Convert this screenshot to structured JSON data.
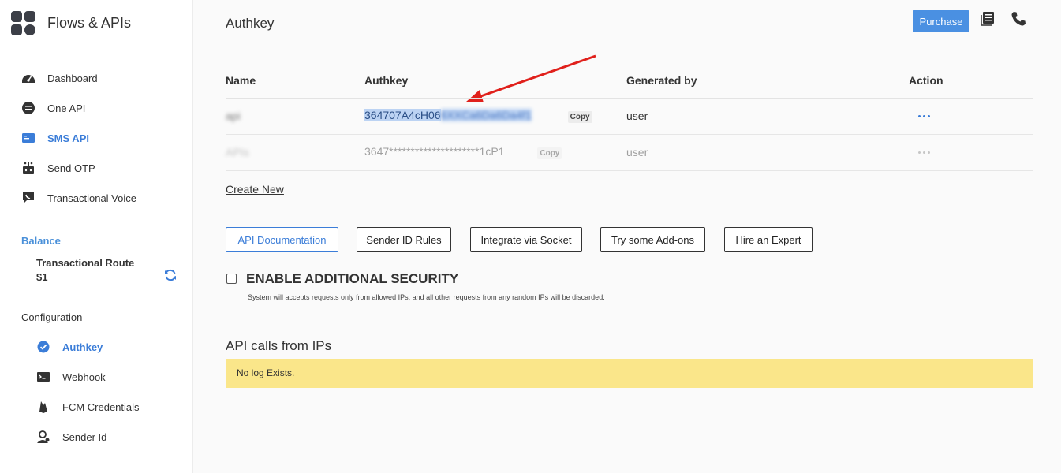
{
  "brand": {
    "title": "Flows & APIs"
  },
  "nav": {
    "items": [
      {
        "label": "Dashboard",
        "icon": "dashboard-icon"
      },
      {
        "label": "One API",
        "icon": "one-api-icon"
      },
      {
        "label": "SMS API",
        "icon": "sms-api-icon",
        "active": true
      },
      {
        "label": "Send OTP",
        "icon": "send-otp-icon"
      },
      {
        "label": "Transactional Voice",
        "icon": "voice-icon"
      }
    ]
  },
  "balance": {
    "title": "Balance",
    "route": "Transactional Route",
    "amount": "$1"
  },
  "configuration": {
    "title": "Configuration",
    "items": [
      {
        "label": "Authkey",
        "icon": "check-circle-icon",
        "active": true
      },
      {
        "label": "Webhook",
        "icon": "terminal-icon"
      },
      {
        "label": "FCM Credentials",
        "icon": "firebase-icon"
      },
      {
        "label": "Sender Id",
        "icon": "user-badge-icon"
      }
    ]
  },
  "header": {
    "title": "Authkey",
    "purchase_label": "Purchase"
  },
  "table": {
    "columns": [
      "Name",
      "Authkey",
      "Generated by",
      "Action"
    ],
    "rows": [
      {
        "name": "api",
        "key_visible": "364707A4cH06",
        "key_hidden": "6XXCa6Da6Da4f1",
        "copy_label": "Copy",
        "generated_by": "user"
      },
      {
        "name": "APIs",
        "key_masked": "3647*********************1cP1",
        "copy_label": "Copy",
        "generated_by": "user"
      }
    ]
  },
  "create_new": "Create New",
  "buttons": {
    "api_docs": "API Documentation",
    "sender_rules": "Sender ID Rules",
    "socket": "Integrate via Socket",
    "addons": "Try some Add-ons",
    "expert": "Hire an Expert"
  },
  "security": {
    "title": "ENABLE ADDITIONAL SECURITY",
    "description": "System will accepts requests only from allowed IPs, and all other requests from any random IPs will be discarded."
  },
  "ip_calls": {
    "title": "API calls from IPs",
    "empty_text": "No log Exists."
  },
  "colors": {
    "accent": "#3b7dd8",
    "purchase": "#4a90e2",
    "notice": "#fae68a",
    "annotation_arrow": "#e0201b"
  }
}
